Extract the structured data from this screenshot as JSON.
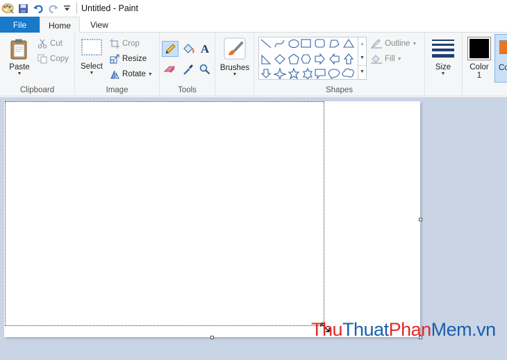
{
  "window": {
    "title": "Untitled - Paint"
  },
  "tabs": [
    {
      "label": "File"
    },
    {
      "label": "Home"
    },
    {
      "label": "View"
    }
  ],
  "clipboard": {
    "paste": "Paste",
    "cut": "Cut",
    "copy": "Copy",
    "label": "Clipboard"
  },
  "image": {
    "select": "Select",
    "crop": "Crop",
    "resize": "Resize",
    "rotate": "Rotate",
    "label": "Image"
  },
  "tools": {
    "label": "Tools",
    "text_glyph": "A"
  },
  "brushes": {
    "label": "Brushes"
  },
  "shapes": {
    "outline": "Outline",
    "fill": "Fill",
    "label": "Shapes"
  },
  "size": {
    "label": "Size"
  },
  "colors": {
    "color1_line1": "Color",
    "color1_line2": "1",
    "color2_partial": "Co",
    "color1": "#000000",
    "color2": "#e87722"
  },
  "watermark": {
    "part1": "Thu",
    "part2": "Thuat",
    "part3": "Phan",
    "part4": "Mem",
    "part5": ".vn"
  }
}
